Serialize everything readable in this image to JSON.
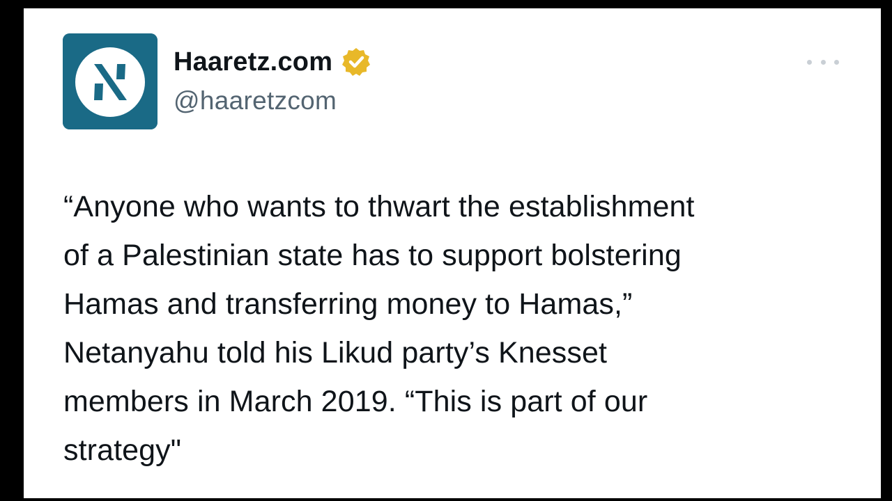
{
  "author": {
    "display_name": "Haaretz.com",
    "handle": "@haaretzcom",
    "verified": true,
    "avatar_icon": "haaretz-logo-icon",
    "badge_icon": "gold-verified-badge-icon"
  },
  "menu": {
    "icon": "more-options-icon"
  },
  "tweet": {
    "text": "“Anyone who wants to thwart the establishment\nof a Palestinian state has to support bolstering\nHamas and transferring money to Hamas,”\nNetanyahu told his Likud party’s Knesset\nmembers in March 2019. “This is part of our\nstrategy\""
  },
  "colors": {
    "avatar_bg": "#1a6a86",
    "badge_gold": "#e8b829",
    "text_primary": "#0f1419",
    "text_secondary": "#536471",
    "background": "#ffffff",
    "frame": "#000000"
  }
}
